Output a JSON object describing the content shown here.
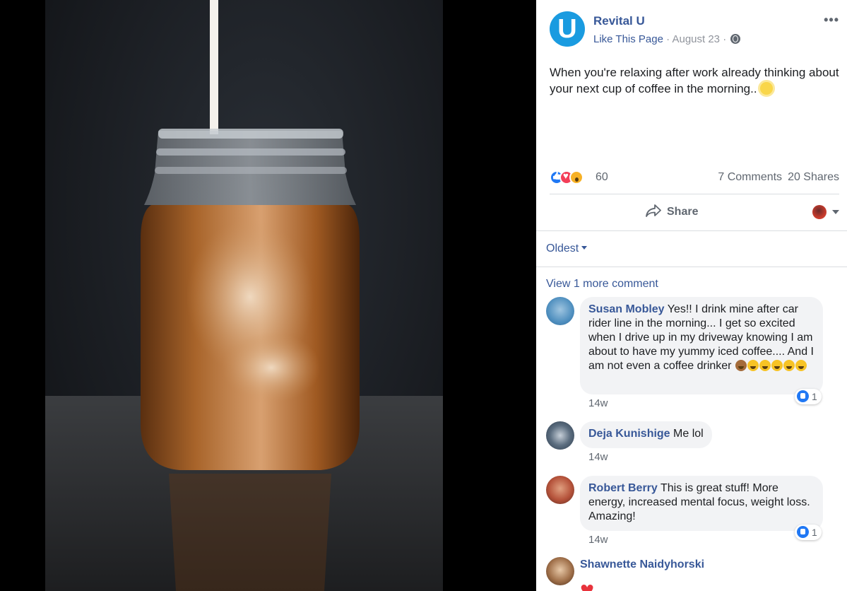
{
  "page": {
    "name": "Revital U",
    "avatar_letter": "U",
    "like_link": "Like This Page",
    "date": "August 23",
    "separator": "·"
  },
  "post": {
    "text": "When you're relaxing after work already thinking about your next cup of coffee in the morning.."
  },
  "stats": {
    "reaction_count": "60",
    "comments": "7 Comments",
    "shares": "20 Shares"
  },
  "actions": {
    "share_label": "Share"
  },
  "comments_section": {
    "sort_label": "Oldest",
    "view_more": "View 1 more comment",
    "comments": [
      {
        "author": "Susan Mobley",
        "text": "Yes!! I drink mine after car rider line in the morning... I get so excited when I drive up in my driveway knowing I am about to have my yummy iced coffee.... And I am not even a coffee drinker",
        "time": "14w",
        "likes": "1"
      },
      {
        "author": "Deja Kunishige",
        "text": "Me lol",
        "time": "14w"
      },
      {
        "author": "Robert Berry",
        "text": "This is great stuff! More energy, increased mental focus, weight loss. Amazing!",
        "time": "14w",
        "likes": "1"
      },
      {
        "author": "Shawnette Naidyhorski"
      }
    ]
  },
  "colors": {
    "link_blue": "#385898",
    "page_avatar": "#1a9be0",
    "like_blue": "#2078f4",
    "love_red": "#f33e58"
  },
  "icons": [
    "globe-icon",
    "more-icon",
    "share-icon",
    "caret-icon",
    "like-reaction-icon",
    "love-reaction-icon",
    "wow-reaction-icon",
    "heart-icon",
    "sun-emoji-icon"
  ]
}
